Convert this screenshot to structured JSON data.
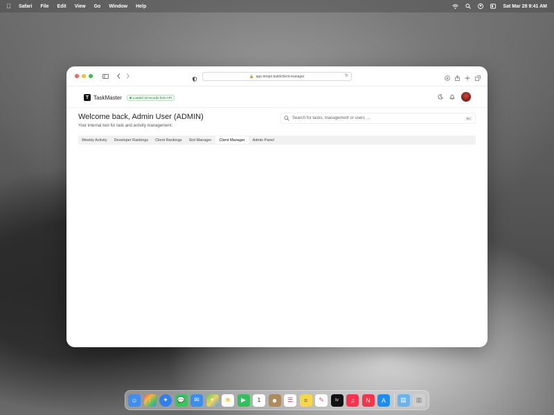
{
  "menubar": {
    "app_name": "Safari",
    "items": [
      "File",
      "Edit",
      "View",
      "Go",
      "Window",
      "Help"
    ],
    "datetime": "Sat Mar 28  9:41 AM",
    "icons": [
      "wifi-icon",
      "search-icon",
      "user-icon",
      "control-center-icon"
    ]
  },
  "browser": {
    "url": "app.tempo.build/client-manager"
  },
  "app": {
    "brand": "TaskMaster",
    "logo_letter": "T",
    "status_badge": "Loaded 18 records from API",
    "welcome": "Welcome back, Admin User (ADMIN)",
    "subtitle": "Your internal tool for task and activity management.",
    "search": {
      "placeholder": "Search for tasks, management or users ...",
      "shortcut": "⌘K"
    },
    "tabs": [
      {
        "label": "Weekly Activity",
        "active": false
      },
      {
        "label": "Developer Rankings",
        "active": false
      },
      {
        "label": "Client Rankings",
        "active": false
      },
      {
        "label": "Slot Manager",
        "active": false
      },
      {
        "label": "Client Manager",
        "active": true
      },
      {
        "label": "Admin Panel",
        "active": false
      }
    ]
  },
  "dock": {
    "apps": [
      {
        "name": "finder-icon",
        "color": "#3d8df5"
      },
      {
        "name": "launchpad-icon",
        "color": "#e84f6a"
      },
      {
        "name": "safari-icon",
        "color": "#2f80ed"
      },
      {
        "name": "messages-icon",
        "color": "#34c759"
      },
      {
        "name": "mail-icon",
        "color": "#3a8ef0"
      },
      {
        "name": "maps-icon",
        "color": "#5ac85a"
      },
      {
        "name": "photos-icon",
        "color": "#f4b93a"
      },
      {
        "name": "facetime-icon",
        "color": "#2fc25b"
      },
      {
        "name": "calendar-icon",
        "color": "#ffffff"
      },
      {
        "name": "contacts-icon",
        "color": "#b08a5a"
      },
      {
        "name": "reminders-icon",
        "color": "#ffffff"
      },
      {
        "name": "notes-icon",
        "color": "#f7d74a"
      },
      {
        "name": "freeform-icon",
        "color": "#ffffff"
      },
      {
        "name": "tv-icon",
        "color": "#111111"
      },
      {
        "name": "music-icon",
        "color": "#f9334f"
      },
      {
        "name": "news-icon",
        "color": "#f5344a"
      },
      {
        "name": "app-store-icon",
        "color": "#1c8cf7"
      }
    ],
    "extras": [
      {
        "name": "downloads-folder-icon",
        "color": "#6ab3ec"
      },
      {
        "name": "trash-icon",
        "color": "#cfcfcf"
      }
    ],
    "calendar_day": "1"
  }
}
